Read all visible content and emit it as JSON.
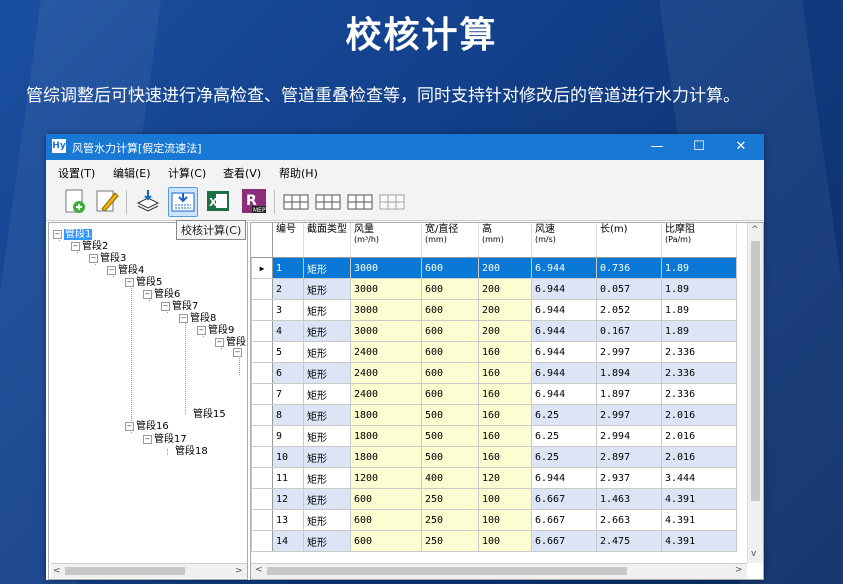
{
  "headline": "校核计算",
  "subtitle": "管综调整后可快速进行净高检查、管道重叠检查等，同时支持针对修改后的管道进行水力计算。",
  "window": {
    "title": "风管水力计算[假定流速法]",
    "app_icon": "Hy",
    "controls": {
      "minimize": "—",
      "maximize": "☐",
      "close": "✕"
    }
  },
  "menu": [
    "设置(T)",
    "编辑(E)",
    "计算(C)",
    "查看(V)",
    "帮助(H)"
  ],
  "toolbar": {
    "tooltip": "校核计算(C)",
    "icons": [
      "new-file-icon",
      "edit-icon",
      "import-icon",
      "check-calc-icon",
      "excel-icon",
      "revit-mep-icon",
      "table-option-1-icon",
      "table-option-2-icon",
      "table-option-3-icon",
      "table-option-4-icon"
    ],
    "mep_label": "MEP"
  },
  "tree": {
    "nodes": [
      "管段1",
      "管段2",
      "管段3",
      "管段4",
      "管段5",
      "管段6",
      "管段7",
      "管段8",
      "管段9",
      "管段",
      "管段15",
      "管段16",
      "管段17",
      "管段18"
    ],
    "expand_symbol": "−"
  },
  "table": {
    "columns": [
      {
        "label": "编号",
        "unit": ""
      },
      {
        "label": "截面类型",
        "unit": ""
      },
      {
        "label": "风量",
        "unit": "(m³/h)"
      },
      {
        "label": "宽/直径",
        "unit": "(mm)"
      },
      {
        "label": "高",
        "unit": "(mm)"
      },
      {
        "label": "风速",
        "unit": "(m/s)"
      },
      {
        "label": "长(m)",
        "unit": ""
      },
      {
        "label": "比摩阻",
        "unit": "(Pa/m)"
      }
    ],
    "row_marker": "▶",
    "rows": [
      [
        "1",
        "矩形",
        "3000",
        "600",
        "200",
        "6.944",
        "0.736",
        "1.89"
      ],
      [
        "2",
        "矩形",
        "3000",
        "600",
        "200",
        "6.944",
        "0.057",
        "1.89"
      ],
      [
        "3",
        "矩形",
        "3000",
        "600",
        "200",
        "6.944",
        "2.052",
        "1.89"
      ],
      [
        "4",
        "矩形",
        "3000",
        "600",
        "200",
        "6.944",
        "0.167",
        "1.89"
      ],
      [
        "5",
        "矩形",
        "2400",
        "600",
        "160",
        "6.944",
        "2.997",
        "2.336"
      ],
      [
        "6",
        "矩形",
        "2400",
        "600",
        "160",
        "6.944",
        "1.894",
        "2.336"
      ],
      [
        "7",
        "矩形",
        "2400",
        "600",
        "160",
        "6.944",
        "1.897",
        "2.336"
      ],
      [
        "8",
        "矩形",
        "1800",
        "500",
        "160",
        "6.25",
        "2.997",
        "2.016"
      ],
      [
        "9",
        "矩形",
        "1800",
        "500",
        "160",
        "6.25",
        "2.994",
        "2.016"
      ],
      [
        "10",
        "矩形",
        "1800",
        "500",
        "160",
        "6.25",
        "2.897",
        "2.016"
      ],
      [
        "11",
        "矩形",
        "1200",
        "400",
        "120",
        "6.944",
        "2.937",
        "3.444"
      ],
      [
        "12",
        "矩形",
        "600",
        "250",
        "100",
        "6.667",
        "1.463",
        "4.391"
      ],
      [
        "13",
        "矩形",
        "600",
        "250",
        "100",
        "6.667",
        "2.663",
        "4.391"
      ],
      [
        "14",
        "矩形",
        "600",
        "250",
        "100",
        "6.667",
        "2.475",
        "4.391"
      ]
    ]
  },
  "colors": {
    "background": "#13418c",
    "titlebar": "#1978d4",
    "selected_row": "#0a78d7",
    "odd_row": "#dbe5f5",
    "input_cell": "#fdfdd2"
  }
}
